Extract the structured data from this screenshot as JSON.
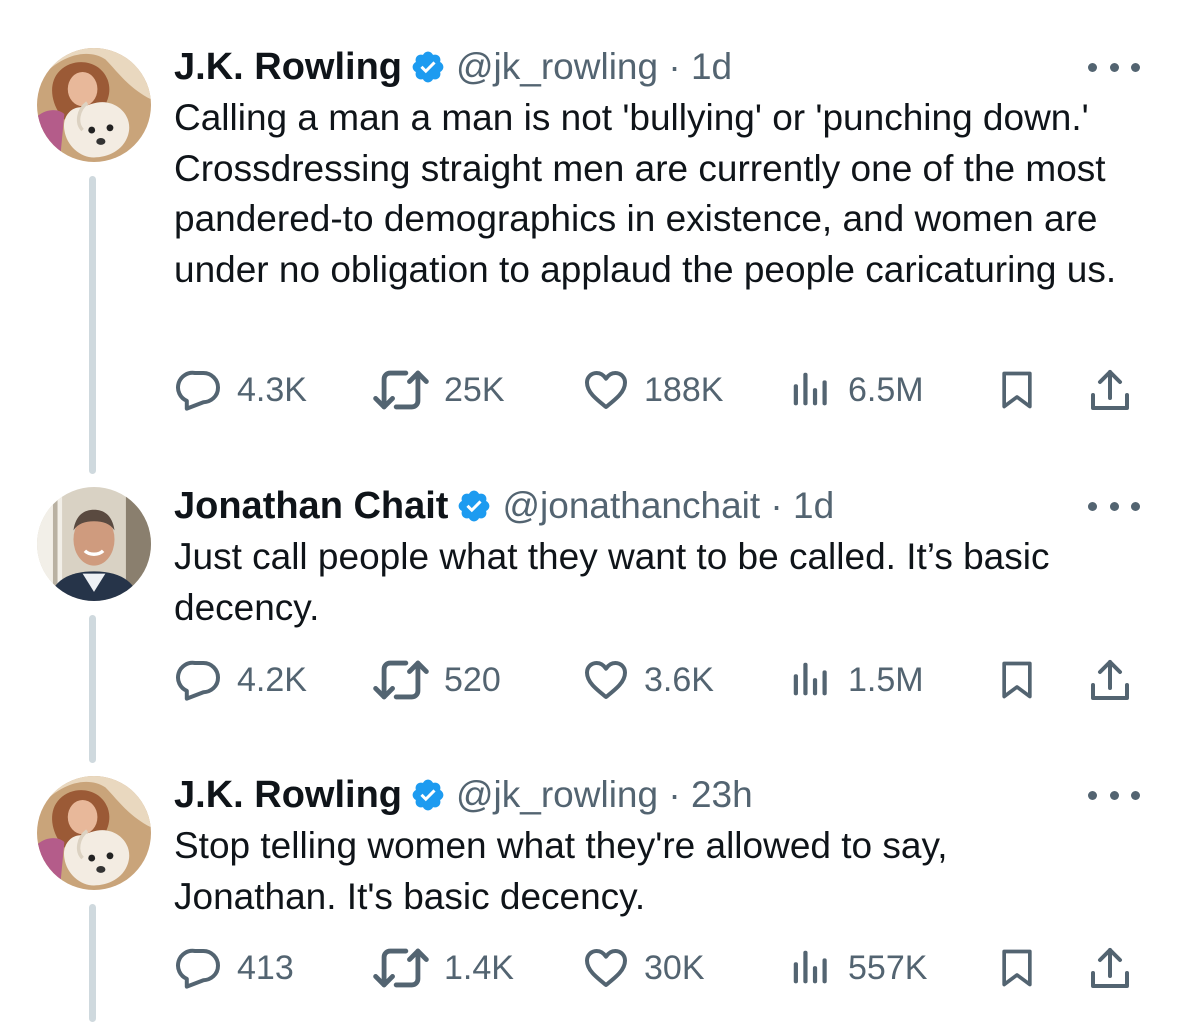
{
  "tweets": [
    {
      "name": "J.K. Rowling",
      "handle": "@jk_rowling",
      "time": "1d",
      "handle_time": "@jk_rowling · 1d",
      "text": "Calling a man a man is not 'bullying' or 'punching down.' Crossdressing straight men are currently one of the most pandered-to demographics in existence, and women are under no obligation to applaud the people caricaturing us.",
      "replies": "4.3K",
      "reposts": "25K",
      "likes": "188K",
      "views": "6.5M"
    },
    {
      "name": "Jonathan Chait",
      "handle": "@jonathanchait",
      "time": "1d",
      "handle_time": "@jonathanchait · 1d",
      "text": "Just call people what they want to be called. It’s basic decency.",
      "replies": "4.2K",
      "reposts": "520",
      "likes": "3.6K",
      "views": "1.5M"
    },
    {
      "name": "J.K. Rowling",
      "handle": "@jk_rowling",
      "time": "23h",
      "handle_time": "@jk_rowling · 23h",
      "text": "Stop telling women what they're allowed to say, Jonathan. It's basic decency.",
      "replies": "413",
      "reposts": "1.4K",
      "likes": "30K",
      "views": "557K"
    }
  ],
  "icons": {
    "verified": "verified-badge-icon",
    "reply": "reply-bubble-icon",
    "repost": "repost-arrows-icon",
    "like": "heart-icon",
    "views": "views-bar-chart-icon",
    "bookmark": "bookmark-icon",
    "share": "share-upload-icon",
    "more": "more-dots-icon"
  },
  "colors": {
    "text": "#0f1419",
    "secondary": "#536471",
    "verified": "#1d9bf0",
    "thread_line": "#cfd9de"
  }
}
